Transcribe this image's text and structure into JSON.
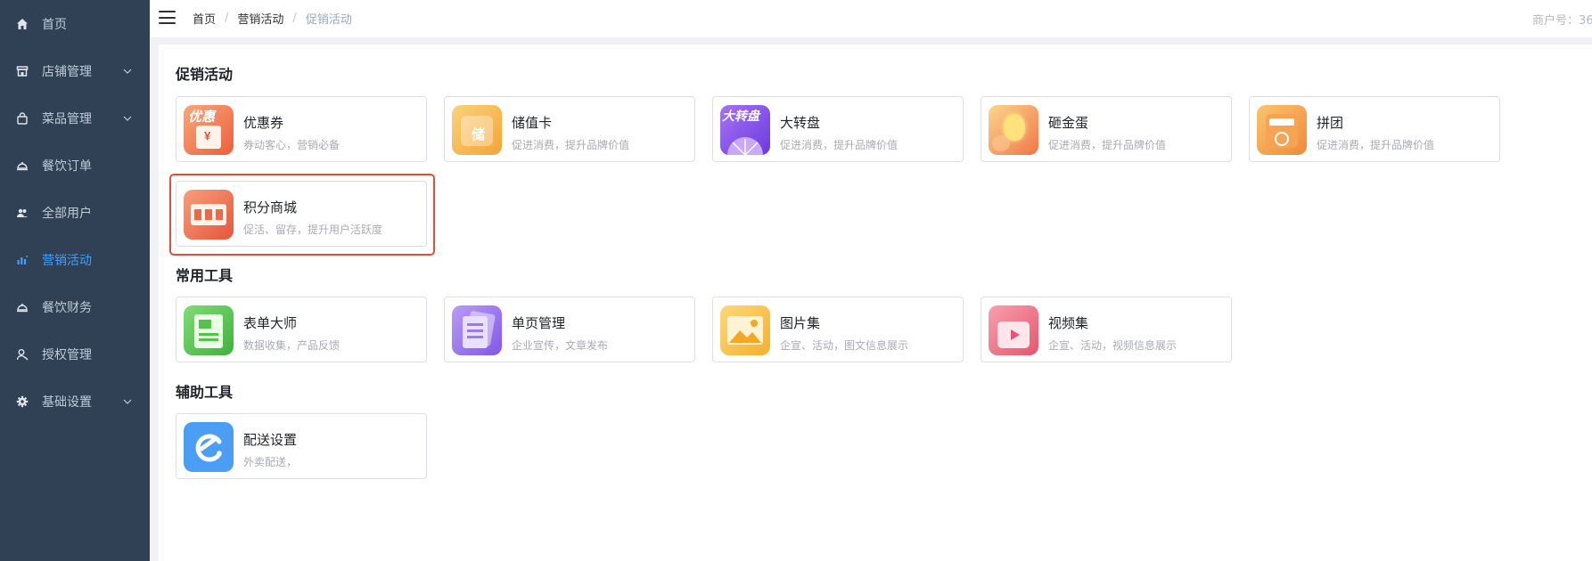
{
  "sidebar": {
    "items": [
      {
        "label": "首页",
        "icon": "home-icon"
      },
      {
        "label": "店铺管理",
        "icon": "store-icon",
        "expandable": true
      },
      {
        "label": "菜品管理",
        "icon": "bag-icon",
        "expandable": true
      },
      {
        "label": "餐饮订单",
        "icon": "cloche-icon"
      },
      {
        "label": "全部用户",
        "icon": "users-icon"
      },
      {
        "label": "营销活动",
        "icon": "chart-icon",
        "active": true
      },
      {
        "label": "餐饮财务",
        "icon": "cloche-icon"
      },
      {
        "label": "授权管理",
        "icon": "user-key-icon"
      },
      {
        "label": "基础设置",
        "icon": "gear-icon",
        "expandable": true
      }
    ],
    "colors": {
      "bg": "#304156",
      "text": "#bfcbd9",
      "active": "#409eff"
    }
  },
  "header": {
    "breadcrumb": [
      "首页",
      "营销活动",
      "促销活动"
    ],
    "merchant_label": "商户号：36"
  },
  "sections": [
    {
      "title": "促销活动",
      "cards": [
        {
          "title": "优惠券",
          "desc": "券动客心，营销必备",
          "icon": "coupon-icon"
        },
        {
          "title": "储值卡",
          "desc": "促进消费，提升品牌价值",
          "icon": "stored-value-card-icon"
        },
        {
          "title": "大转盘",
          "desc": "促进消费，提升品牌价值",
          "icon": "wheel-icon"
        },
        {
          "title": "砸金蛋",
          "desc": "促进消费，提升品牌价值",
          "icon": "golden-egg-icon"
        },
        {
          "title": "拼团",
          "desc": "促进消费，提升品牌价值",
          "icon": "group-buy-icon"
        },
        {
          "title": "积分商城",
          "desc": "促活、留存，提升用户活跃度",
          "icon": "points-mall-icon",
          "highlighted": true
        }
      ]
    },
    {
      "title": "常用工具",
      "cards": [
        {
          "title": "表单大师",
          "desc": "数据收集，产品反馈",
          "icon": "form-icon"
        },
        {
          "title": "单页管理",
          "desc": "企业宣传，文章发布",
          "icon": "page-icon"
        },
        {
          "title": "图片集",
          "desc": "企宣、活动，图文信息展示",
          "icon": "image-gallery-icon"
        },
        {
          "title": "视频集",
          "desc": "企宣、活动，视频信息展示",
          "icon": "video-gallery-icon"
        }
      ]
    },
    {
      "title": "辅助工具",
      "cards": [
        {
          "title": "配送设置",
          "desc": "外卖配送，",
          "icon": "delivery-icon"
        }
      ]
    }
  ],
  "icon_text": {
    "coupon": "优惠",
    "coupon_sub": "¥",
    "stored": "储",
    "wheel": "大转盘"
  },
  "highlight_color": "#e04f3a"
}
